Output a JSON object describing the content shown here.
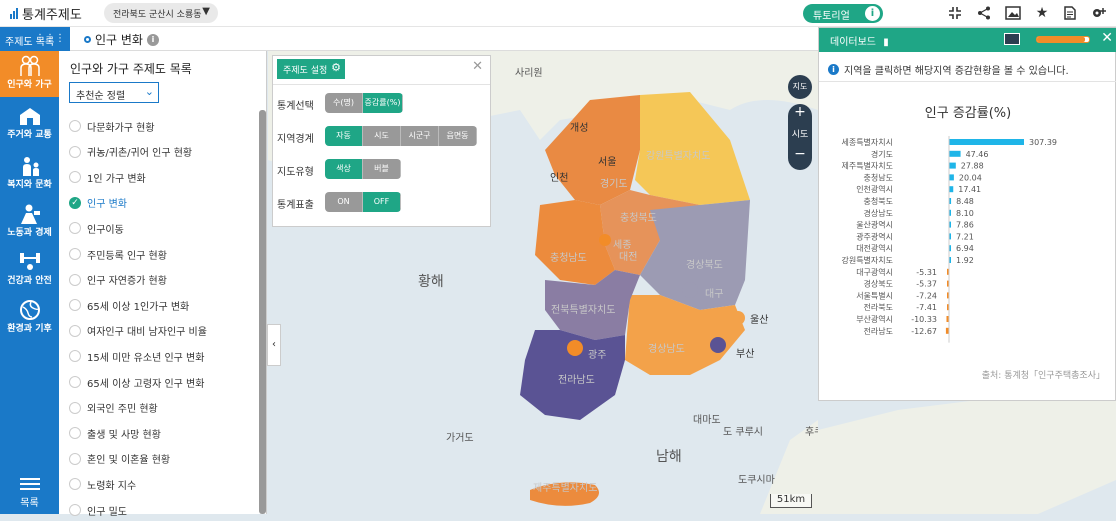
{
  "header": {
    "app_title": "통계주제도",
    "region_select": "전라북도 군산시 소룡동",
    "tutorial_label": "튜토리얼",
    "icons": [
      "shrink-icon",
      "share-icon",
      "image-icon",
      "star-icon",
      "document-icon",
      "settings-icon"
    ]
  },
  "toolbar": {
    "category_button": "주제도 목록",
    "current_topic": "인구 변화"
  },
  "sidebar": {
    "items": [
      {
        "label": "인구와 가구",
        "icon": "people-icon",
        "active": true
      },
      {
        "label": "주거와 교통",
        "icon": "house-icon"
      },
      {
        "label": "복지와 문화",
        "icon": "welfare-icon"
      },
      {
        "label": "노동과 경제",
        "icon": "worker-icon"
      },
      {
        "label": "건강과 안전",
        "icon": "health-icon"
      },
      {
        "label": "환경과 기후",
        "icon": "globe-icon"
      }
    ],
    "menu_label": "목록"
  },
  "list": {
    "title": "인구와 가구 주제도 목록",
    "sort_label": "추천순 정렬",
    "items": [
      "다문화가구 현황",
      "귀농/귀촌/귀어 인구 현황",
      "1인 가구 변화",
      "인구 변화",
      "인구이동",
      "주민등록 인구 현황",
      "인구 자연증가 현황",
      "65세 이상 1인가구 변화",
      "여자인구 대비 남자인구 비율",
      "15세 미만 유소년 인구 변화",
      "65세 이상 고령자 인구 변화",
      "외국인 주민 현황",
      "출생 및 사망 현황",
      "혼인 및 이혼율 현황",
      "노령화 지수",
      "인구 밀도"
    ],
    "selected_index": 3
  },
  "theme_settings": {
    "button_label": "주제도 설정",
    "rows": [
      {
        "label": "통계선택",
        "options": [
          "수(명)",
          "증감률(%)"
        ],
        "selected": 1
      },
      {
        "label": "지역경계",
        "options": [
          "자동",
          "시도",
          "시군구",
          "읍면동"
        ],
        "selected": 0
      },
      {
        "label": "지도유형",
        "options": [
          "색상",
          "버블"
        ],
        "selected": 0
      },
      {
        "label": "통계표출",
        "options": [
          "ON",
          "OFF"
        ],
        "selected": 1
      }
    ]
  },
  "map": {
    "labels": [
      "사리원",
      "개성",
      "서울",
      "인천",
      "강원특별자치도",
      "경기도",
      "충청북도",
      "세종",
      "대전",
      "충청남도",
      "경상북도",
      "대구",
      "울산",
      "부산",
      "전북특별자치도",
      "광주",
      "전라남도",
      "경상남도",
      "황해",
      "남해",
      "가거도",
      "제주특별자치도",
      "대마도",
      "도쿠시마",
      "도 쿠루시",
      "후쿠오카"
    ],
    "compass_label": "지도",
    "zoom_label": "시도",
    "scale": "51km"
  },
  "dashboard": {
    "title": "데이터보드",
    "info": "지역을 클릭하면 해당지역 증감현황을 볼 수 있습니다.",
    "source": "출처: 통계청「인구주택총조사」",
    "colors": {
      "positive": "#1fb5e8",
      "negative": "#f28c28"
    }
  },
  "chart_data": {
    "type": "bar",
    "title": "인구 증감률(%)",
    "categories": [
      "세종특별자치시",
      "경기도",
      "제주특별자치도",
      "충청남도",
      "인천광역시",
      "충청북도",
      "경상남도",
      "울산광역시",
      "광주광역시",
      "대전광역시",
      "강원특별자치도",
      "대구광역시",
      "경상북도",
      "서울특별시",
      "전라북도",
      "부산광역시",
      "전라남도"
    ],
    "values": [
      307.39,
      47.46,
      27.88,
      20.04,
      17.41,
      8.48,
      8.1,
      7.86,
      7.21,
      6.94,
      1.92,
      -5.31,
      -5.37,
      -7.24,
      -7.41,
      -10.33,
      -12.67
    ],
    "value_labels": [
      "307.39",
      "47.46",
      "27.88",
      "20.04",
      "17.41",
      "8.48",
      "8.10",
      "7.86",
      "7.21",
      "6.94",
      "1.92",
      "-5.31",
      "-5.37",
      "-7.24",
      "-7.41",
      "-10.33",
      "-12.67"
    ],
    "orientation": "horizontal"
  }
}
